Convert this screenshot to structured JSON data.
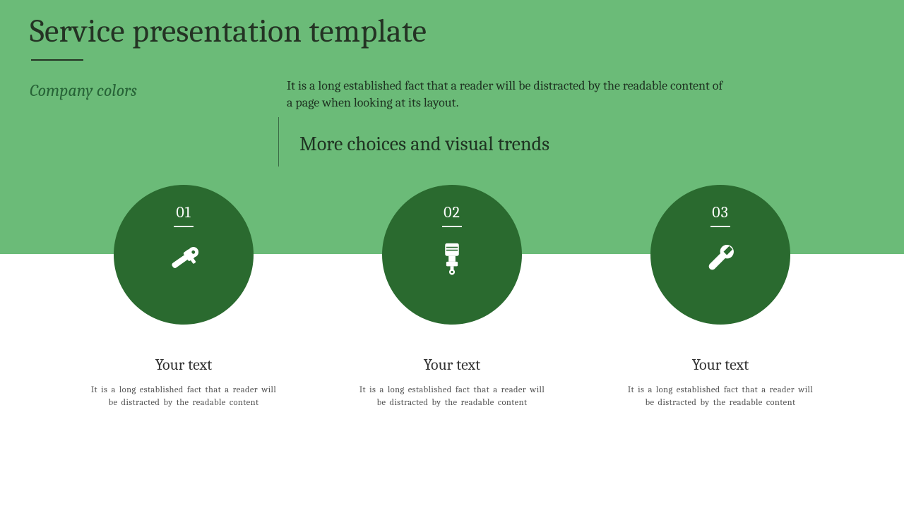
{
  "colors": {
    "band": "#6bbb78",
    "circle": "#2a6a2f",
    "title": "#243324",
    "accent": "#276337"
  },
  "header": {
    "title": "Service presentation template",
    "subtitle": "Company colors",
    "intro": "It is a long established fact that a reader will be distracted by the readable content of a page when looking at its layout.",
    "tagline": "More choices and visual trends"
  },
  "items": [
    {
      "num": "01",
      "icon": "grinder-icon",
      "title": "Your text",
      "desc": "It is a long established fact that a reader will be distracted by the readable content"
    },
    {
      "num": "02",
      "icon": "piston-icon",
      "title": "Your text",
      "desc": "It is a long established fact that a reader will be distracted by the readable content"
    },
    {
      "num": "03",
      "icon": "wrench-icon",
      "title": "Your text",
      "desc": "It is a long established fact that a reader will be distracted by the readable content"
    }
  ]
}
